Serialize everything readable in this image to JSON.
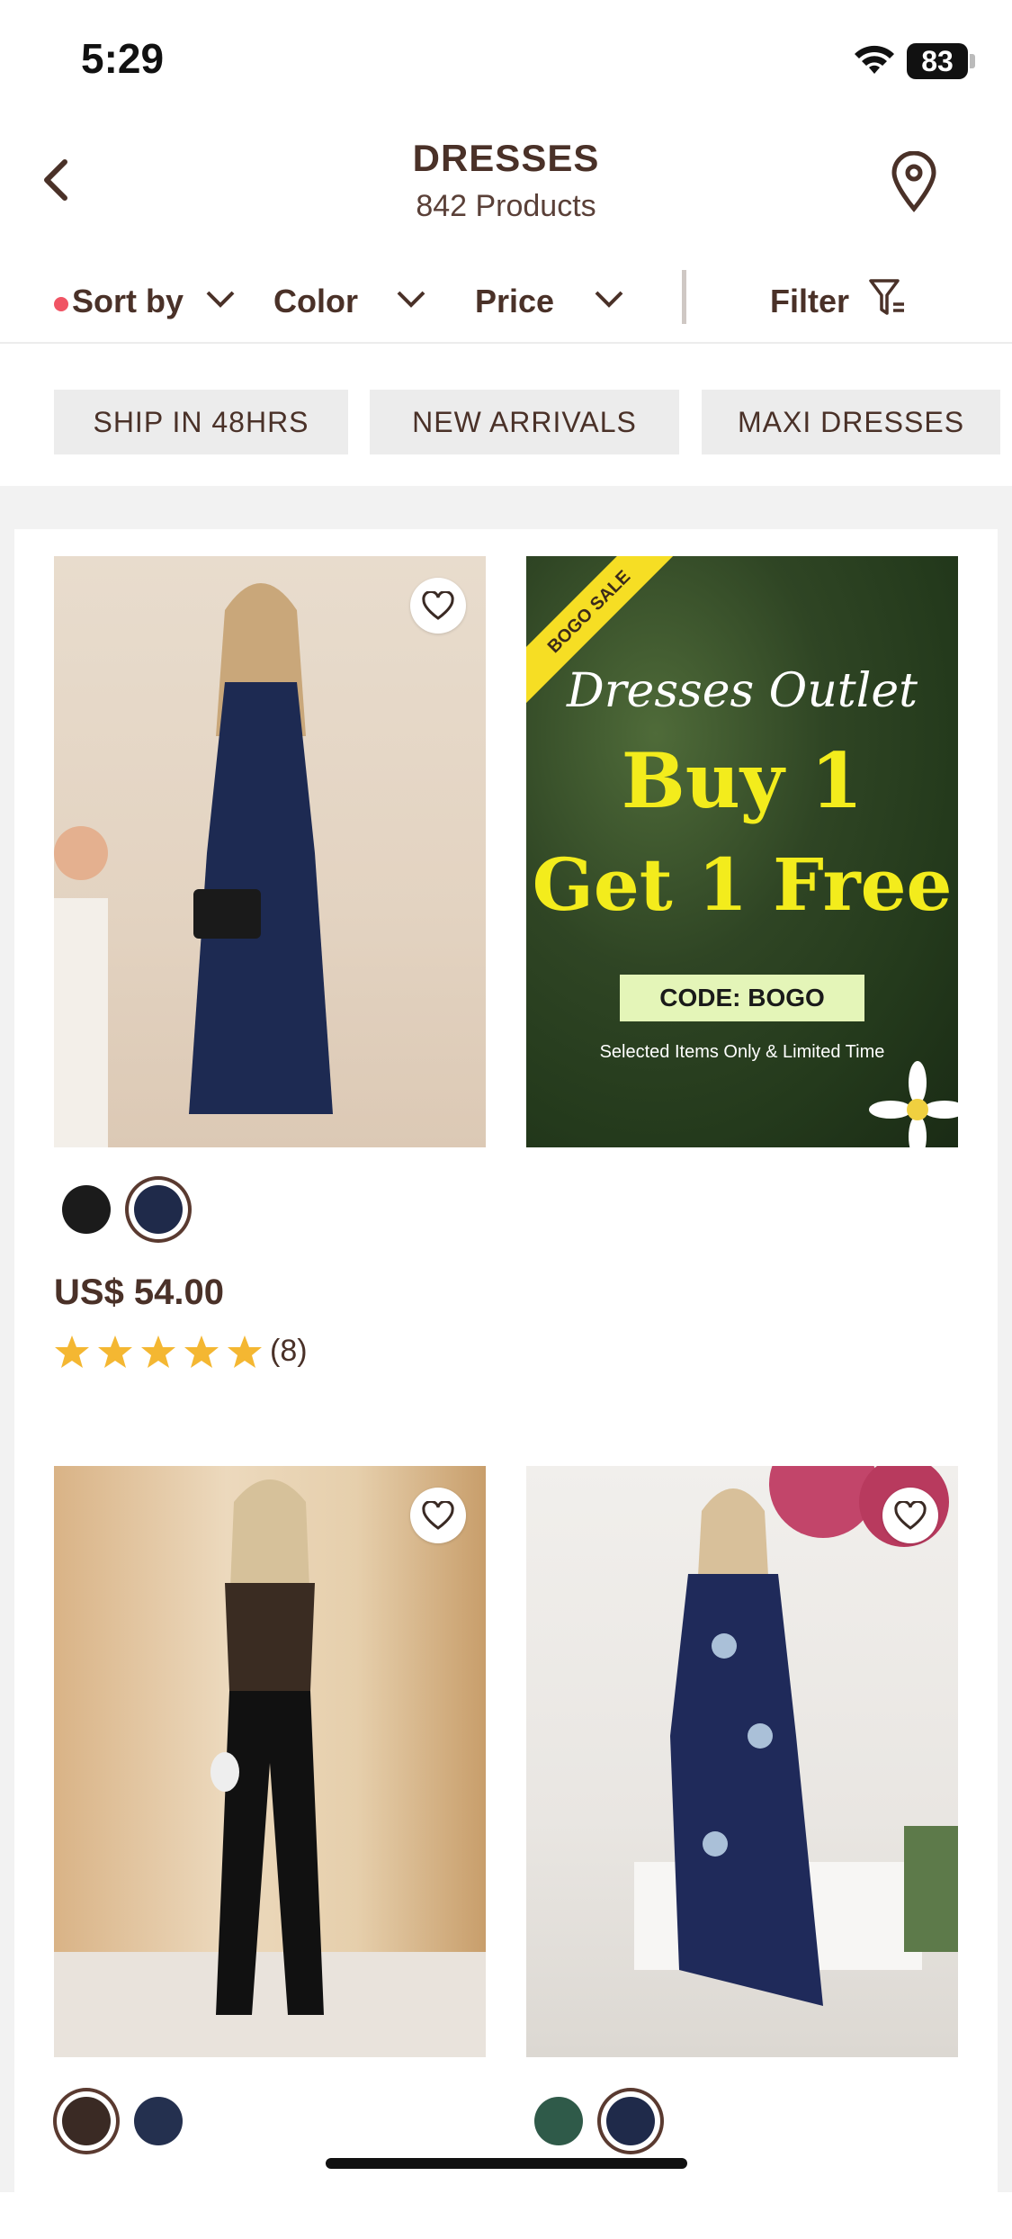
{
  "status": {
    "time": "5:29",
    "battery": "83"
  },
  "header": {
    "title": "DRESSES",
    "subtitle": "842 Products"
  },
  "sortbar": {
    "sort": "Sort by",
    "color": "Color",
    "price": "Price",
    "filter": "Filter"
  },
  "chips": [
    "SHIP IN 48HRS",
    "NEW ARRIVALS",
    "MAXI DRESSES"
  ],
  "banner": {
    "ribbon": "BOGO SALE",
    "script": "Dresses Outlet",
    "line1": "Buy 1",
    "line2": "Get 1 Free",
    "code": "CODE: BOGO",
    "note": "Selected Items Only & Limited Time"
  },
  "products": [
    {
      "price": "US$ 54.00",
      "rating": 5,
      "reviews": "(8)",
      "swatches": [
        "#1b1b1b",
        "#1f2a4a"
      ]
    },
    {
      "swatches": [
        "#3a2a24",
        "#24304f"
      ]
    },
    {
      "swatches": [
        "#2f5a49",
        "#1f2a4a"
      ]
    }
  ],
  "colors": {
    "text": "#4a3128",
    "accent_dot": "#f05464",
    "star": "#f4b732"
  },
  "icons": [
    "back-chevron-icon",
    "location-pin-icon",
    "chevron-down-icon",
    "filter-icon",
    "heart-icon",
    "star-icon",
    "wifi-icon",
    "battery-icon"
  ]
}
